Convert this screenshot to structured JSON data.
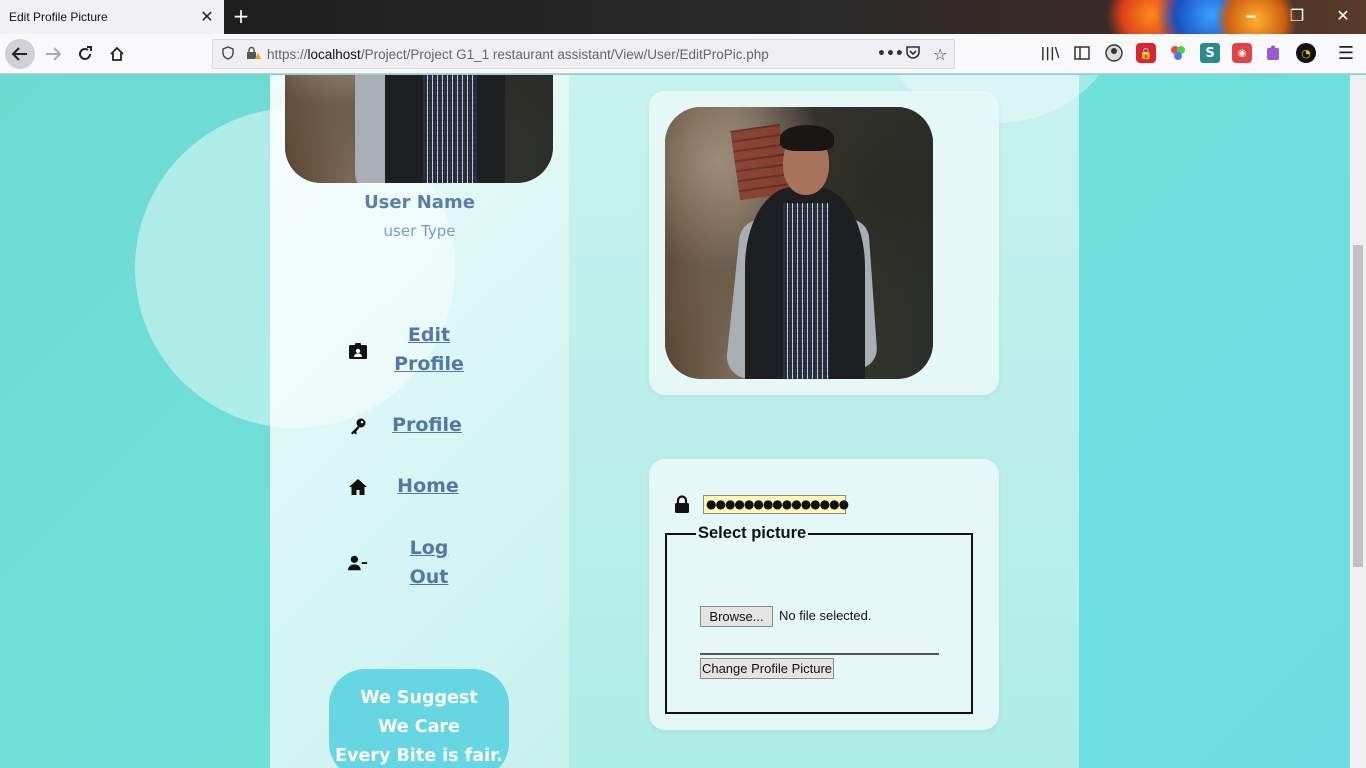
{
  "browser": {
    "tab_title": "Edit Profile Picture",
    "url_prefix": "https://",
    "url_host": "localhost",
    "url_path": "/Project/Project G1_1 restaurant assistant/View/User/EditProPic.php"
  },
  "profile": {
    "user_name": "User Name",
    "user_type": "user Type"
  },
  "menu": [
    {
      "label_line1": "Edit",
      "label_line2": "Profile",
      "icon": "id-card-icon"
    },
    {
      "label": "Profile",
      "icon": "key-icon"
    },
    {
      "label": "Home",
      "icon": "home-icon"
    },
    {
      "label_line1": "Log",
      "label_line2": "Out",
      "icon": "user-minus-icon"
    }
  ],
  "slogan": [
    "We Suggest",
    "We Care",
    "Every Bite is fair."
  ],
  "form": {
    "password_value": "●●●●●●●●●●●●●●●",
    "legend": "Select picture",
    "browse_label": "Browse...",
    "file_status": "No file selected.",
    "submit_label": "Change Profile Picture"
  }
}
